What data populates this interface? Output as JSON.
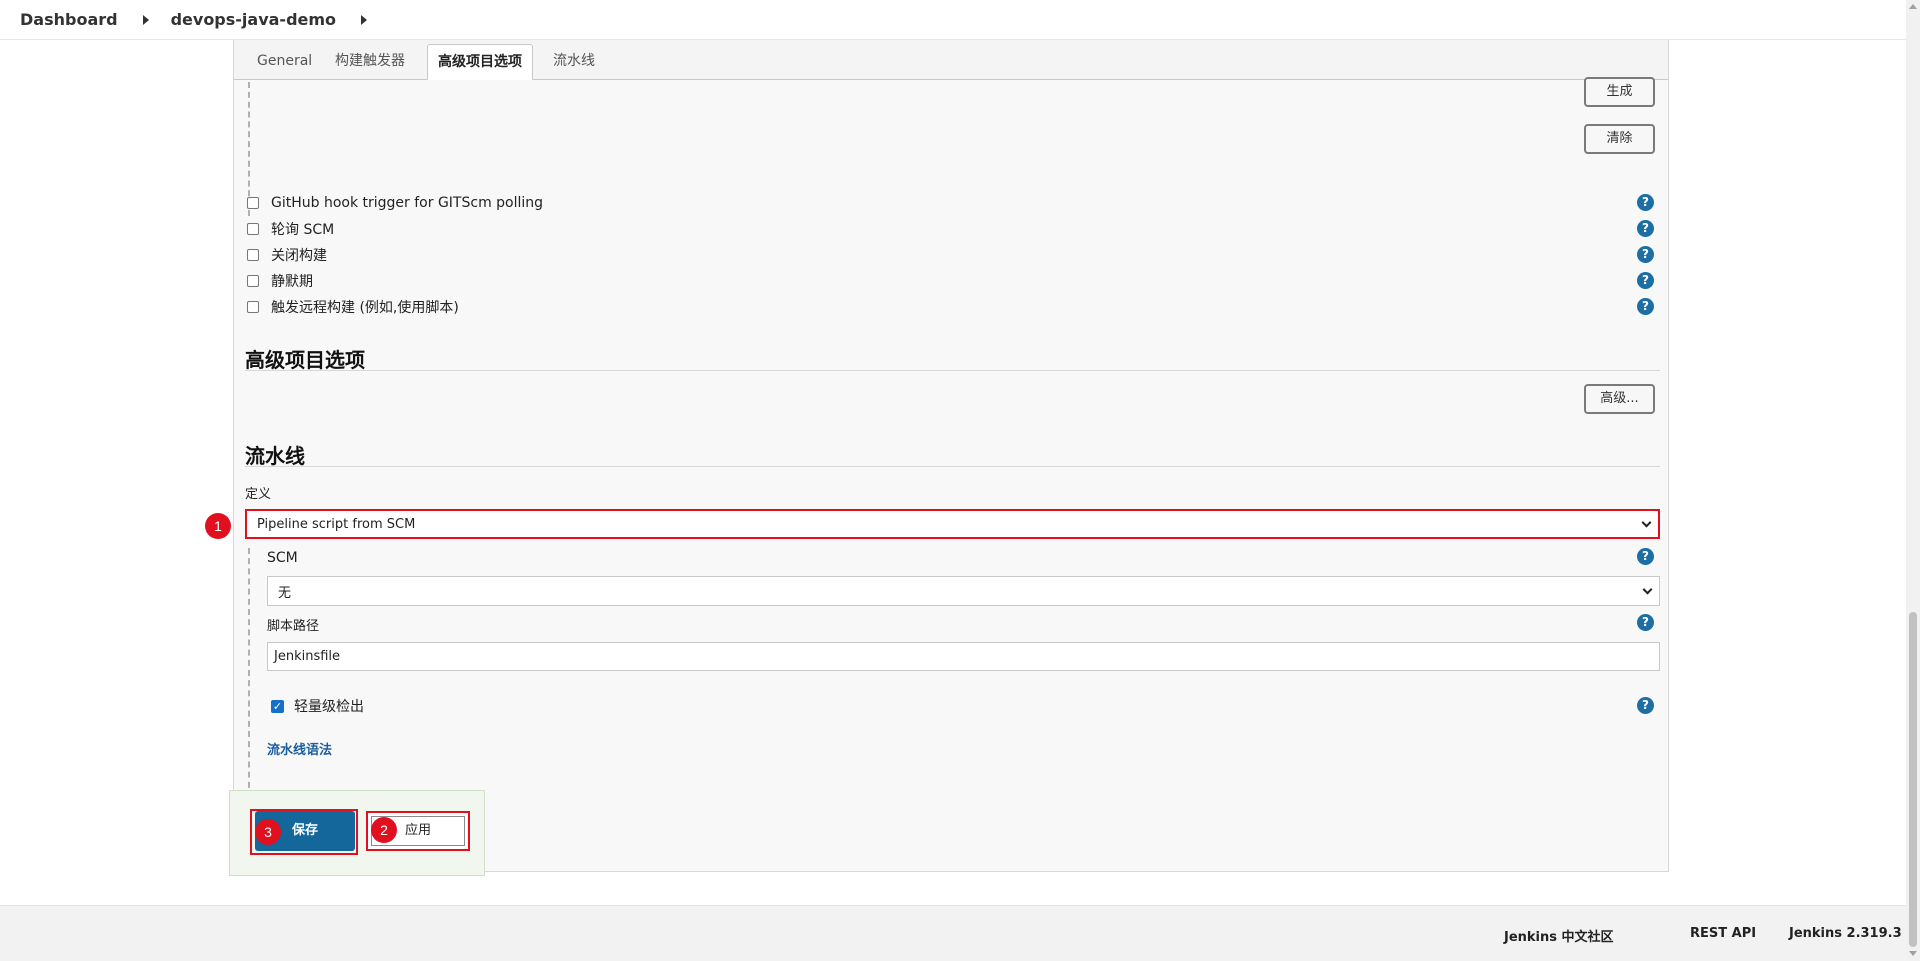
{
  "breadcrumb": {
    "items": [
      "Dashboard",
      "devops-java-demo"
    ]
  },
  "tabs": [
    {
      "label": "General",
      "active": false
    },
    {
      "label": "构建触发器",
      "active": false
    },
    {
      "label": "高级项目选项",
      "active": true
    },
    {
      "label": "流水线",
      "active": false
    }
  ],
  "triggers_section": {
    "generate_button": "生成",
    "clear_button": "清除",
    "options": [
      {
        "label": "GitHub hook trigger for GITScm polling",
        "checked": false
      },
      {
        "label": "轮询 SCM",
        "checked": false
      },
      {
        "label": "关闭构建",
        "checked": false
      },
      {
        "label": "静默期",
        "checked": false
      },
      {
        "label": "触发远程构建 (例如,使用脚本)",
        "checked": false
      }
    ],
    "help_glyph": "?"
  },
  "advanced_section": {
    "title": "高级项目选项",
    "advanced_button": "高级..."
  },
  "pipeline_section": {
    "title": "流水线",
    "definition_label": "定义",
    "definition_value": "Pipeline script from SCM",
    "scm_label": "SCM",
    "scm_value": "无",
    "script_path_label": "脚本路径",
    "script_path_value": "Jenkinsfile",
    "lightweight_checkout_label": "轻量级检出",
    "lightweight_checkout_checked": true,
    "pipeline_syntax_link": "流水线语法"
  },
  "actions": {
    "save_label": "保存",
    "apply_label": "应用"
  },
  "annotations": {
    "marker_1": "1",
    "marker_2": "2",
    "marker_3": "3",
    "color": "#e0101e"
  },
  "footer": {
    "community": "Jenkins 中文社区",
    "rest_api": "REST API",
    "version": "Jenkins 2.319.3"
  },
  "colors": {
    "accent": "#13679b",
    "help_icon": "#1c6ea4",
    "link": "#1c5ea0",
    "highlight": "#e0101e"
  }
}
